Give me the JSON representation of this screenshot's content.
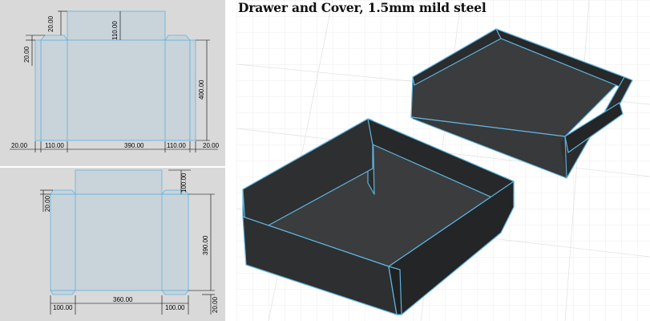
{
  "title": "Drawer and Cover, 1.5mm mild steel",
  "colors": {
    "panel_bg": "#d9d9d9",
    "blank_fill": "#c9d3da",
    "outline": "#5fb4e0",
    "steel_dark": "#2d2f30",
    "steel_floor": "#3a3c3d"
  },
  "top_drawing": {
    "tab_height": "20.00",
    "top_flap": "110.00",
    "left_tab": "20.00",
    "height": "400.00",
    "bottom_left": "20.00",
    "left_flap": "110.00",
    "width": "390.00",
    "right_flap": "110.00",
    "bottom_right": "20.00"
  },
  "bottom_drawing": {
    "top_flap": "100.00",
    "left_tab": "20.00",
    "height": "390.00",
    "left_flap": "100.00",
    "width": "360.00",
    "right_flap": "100.00",
    "bottom_right": "20.00"
  }
}
